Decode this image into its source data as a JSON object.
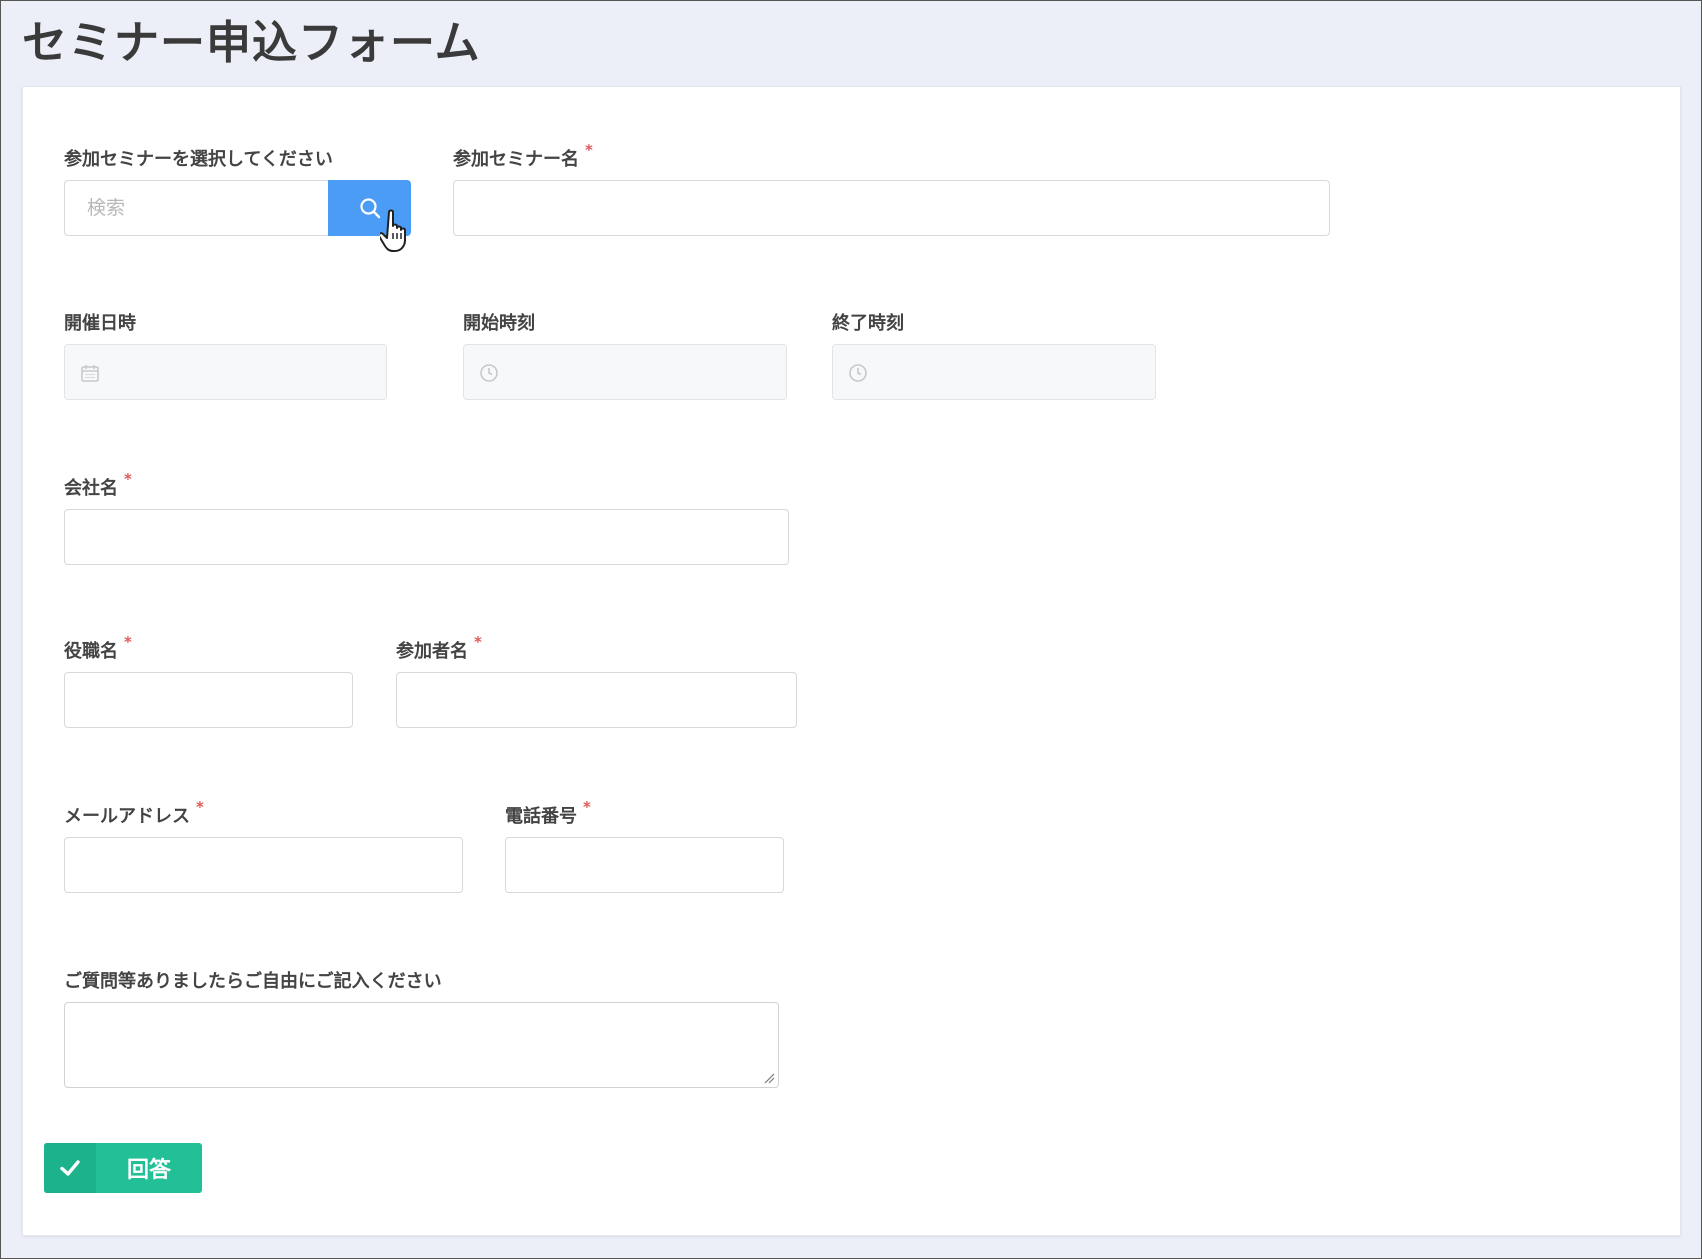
{
  "page": {
    "title": "セミナー申込フォーム"
  },
  "form": {
    "select_seminar": {
      "label": "参加セミナーを選択してください",
      "search_placeholder": "検索"
    },
    "seminar_name": {
      "label": "参加セミナー名",
      "required_mark": "*"
    },
    "event_date": {
      "label": "開催日時"
    },
    "start_time": {
      "label": "開始時刻"
    },
    "end_time": {
      "label": "終了時刻"
    },
    "company": {
      "label": "会社名",
      "required_mark": "*"
    },
    "job_title": {
      "label": "役職名",
      "required_mark": "*"
    },
    "participant": {
      "label": "参加者名",
      "required_mark": "*"
    },
    "email": {
      "label": "メールアドレス",
      "required_mark": "*"
    },
    "phone": {
      "label": "電話番号",
      "required_mark": "*"
    },
    "comments": {
      "label": "ご質問等ありましたらご自由にご記入ください"
    },
    "submit": {
      "label": "回答"
    }
  },
  "colors": {
    "search_button": "#4b9cf5",
    "submit_button": "#23c098",
    "required": "#e05a5a"
  },
  "icons": [
    "search-icon",
    "hand-cursor-icon",
    "calendar-icon",
    "clock-icon",
    "check-icon",
    "resize-handle-icon"
  ]
}
